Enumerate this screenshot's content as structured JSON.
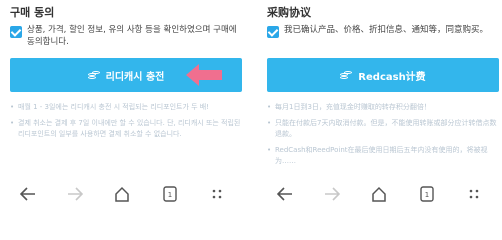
{
  "colors": {
    "accent": "#33b6ec",
    "checkbox": "#2aa7e8",
    "arrow": "#f06f8f",
    "note_text": "#b9c6d2"
  },
  "left": {
    "title": "구매 동의",
    "agree_text": "상품, 가격, 할인 정보, 유의 사항 등을 확인하였으며 구매에 동의합니다.",
    "button_label": "리디캐시 충전",
    "notes": [
      "매월 1 - 3일에는 리디캐시 충전 시 적립되는 리디포인트가 두 배!",
      "결제 취소는 결제 후 7일 이내에만 할 수 있습니다. 단, 리디캐시 또는 적립된 리디포인트의 일부를 사용하면 결제 취소할 수 없습니다."
    ]
  },
  "right": {
    "title": "采购协议",
    "agree_text": "我已确认产品、价格、折扣信息、通知等，同意购买。",
    "button_label": "Redcash计费",
    "notes": [
      "每月1日到3日，充值现金时赚取的转存积分翻倍！",
      "只能在付款后7天内取消付款。但是，不能使用转账或部分应计转借点数退款。",
      "RedCash和ReedPoint在最后使用日期后五年内没有使用的，将被视为……"
    ]
  },
  "navbar": {
    "icons": [
      "back-icon",
      "forward-icon",
      "home-icon",
      "tabs-icon",
      "menu-icon"
    ],
    "tab_count": "1"
  }
}
